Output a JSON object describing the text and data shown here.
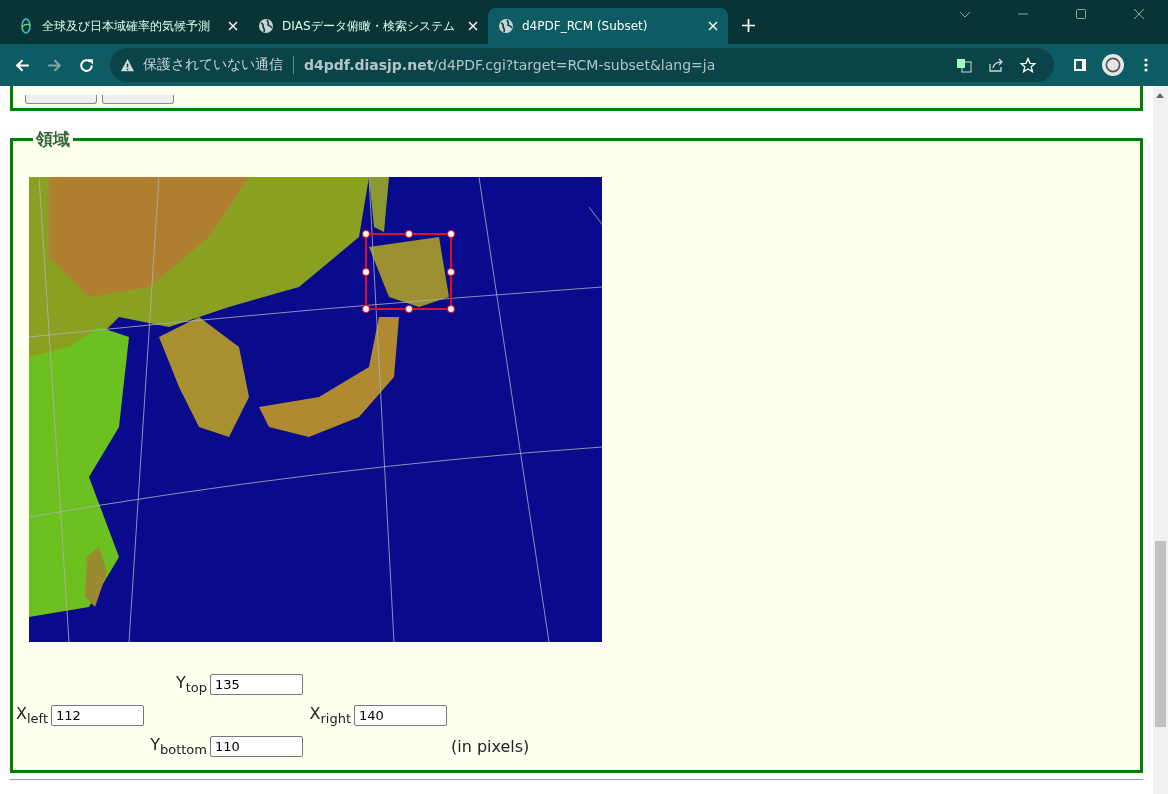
{
  "browser": {
    "tabs": [
      {
        "title": "全球及び日本域確率的気候予測",
        "kind": "logo",
        "selected": false
      },
      {
        "title": "DIASデータ俯瞰・検索システム",
        "kind": "globe",
        "selected": false
      },
      {
        "title": "d4PDF_RCM (Subset)",
        "kind": "globe",
        "selected": true
      }
    ],
    "security_label": "保護されていない通信",
    "url": "**d4pdf.diasjp.net**/d4PDF.cgi?target=RCM-subset&lang=ja"
  },
  "region": {
    "legend": "領域",
    "fields": [
      {
        "label": "Y$_{top}$",
        "value": "135"
      },
      {
        "label": "X$_{left}$",
        "value": "112"
      },
      {
        "label": "X$_{right}$",
        "value": "140"
      },
      {
        "label": "Y$_{bottom}$",
        "value": "110"
      }
    ],
    "unit_note": "(in pixels)"
  }
}
